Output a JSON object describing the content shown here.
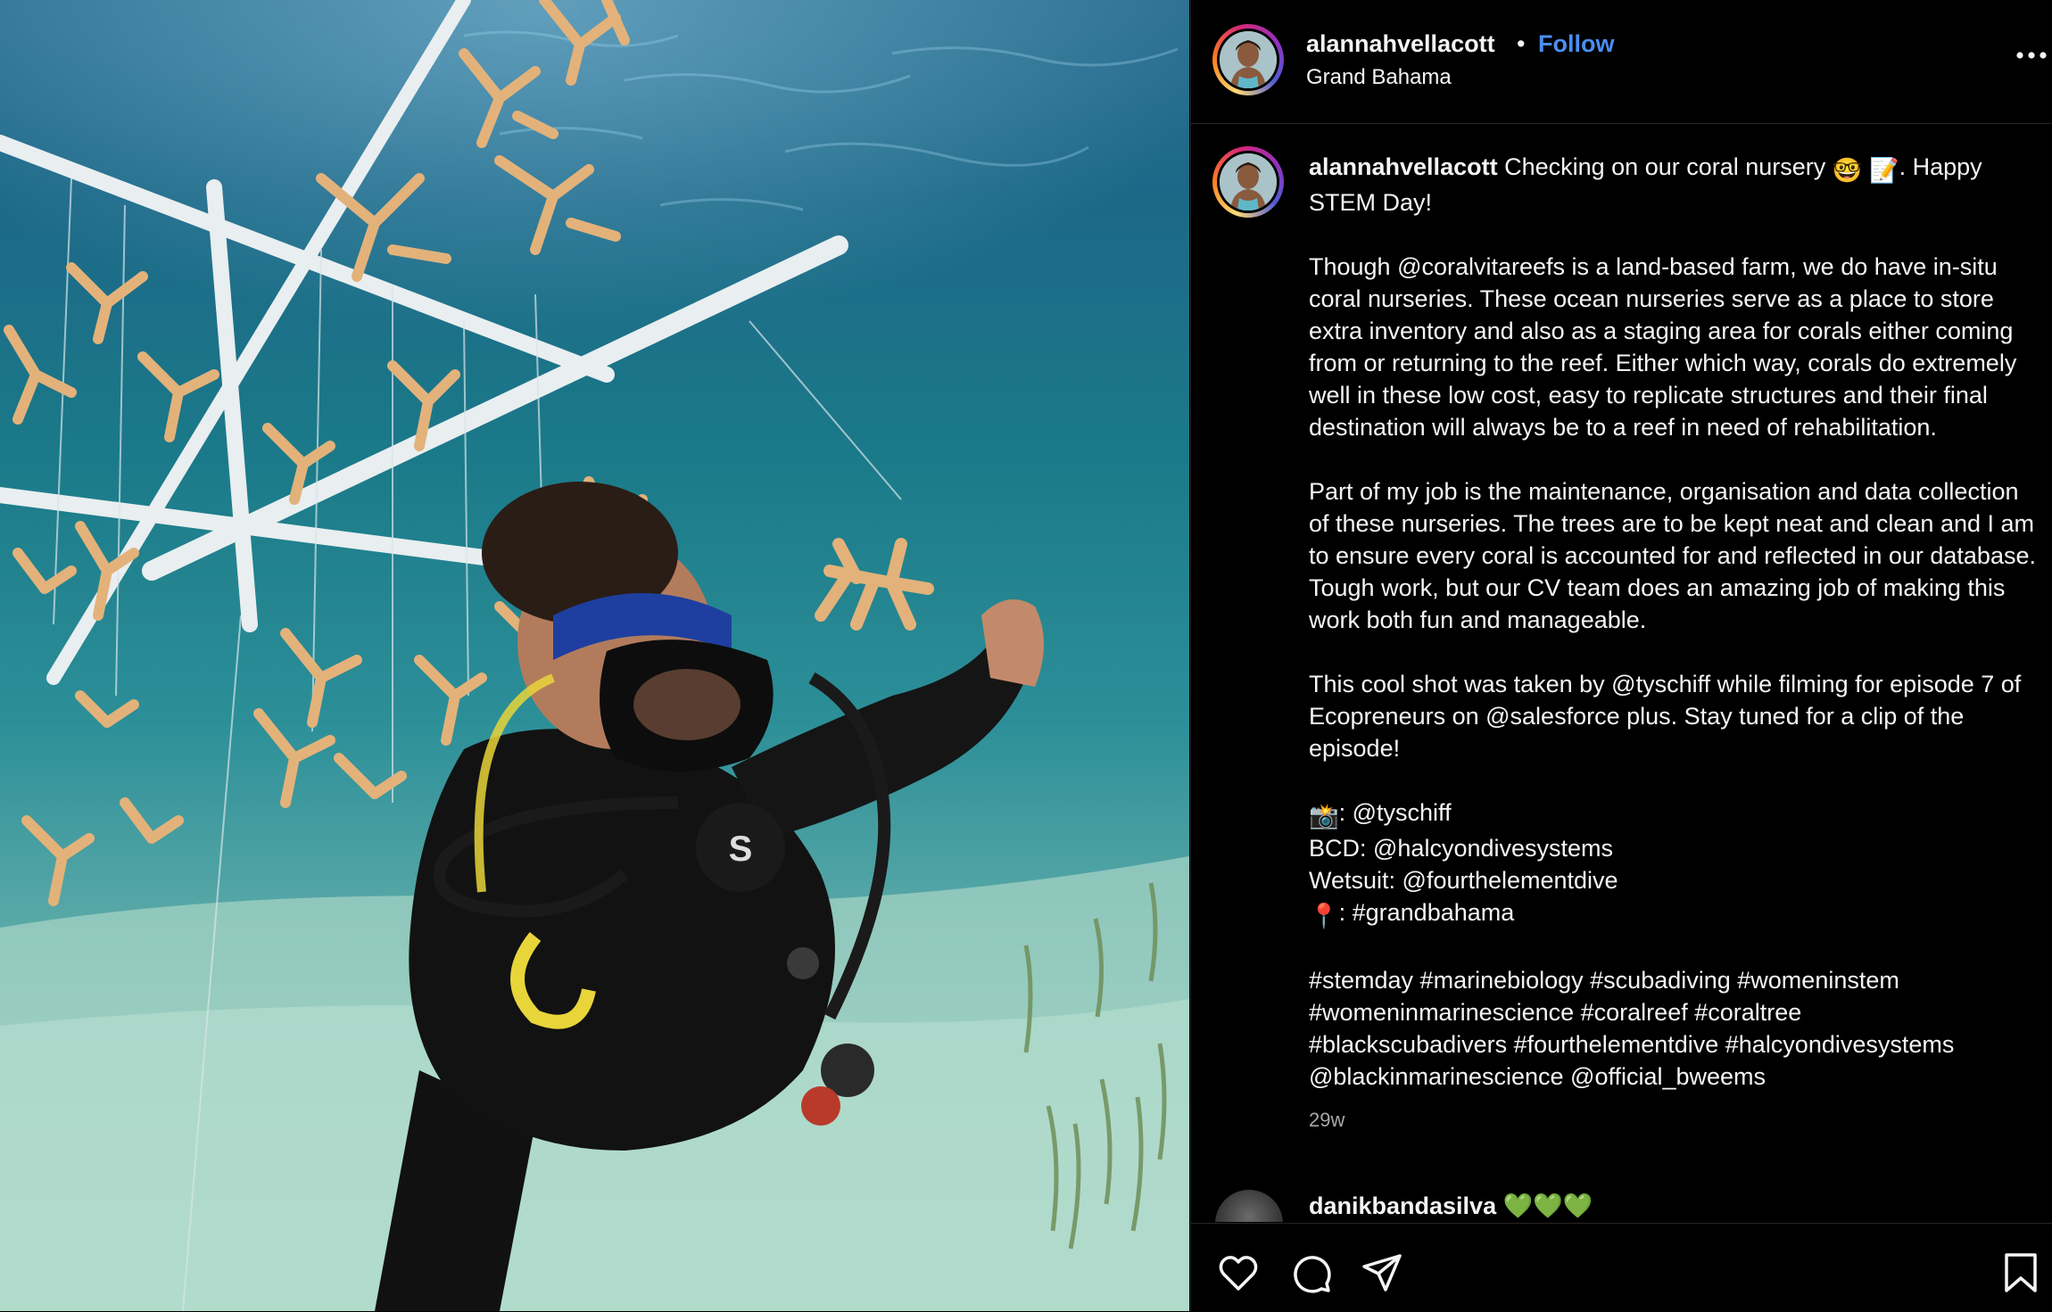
{
  "post": {
    "username": "alannahvellacott",
    "separator": "•",
    "follow_label": "Follow",
    "location": "Grand Bahama"
  },
  "caption": {
    "username": "alannahvellacott",
    "line1": "Checking on our coral nursery",
    "emoji1": "🤓",
    "emoji2": "📝",
    "line1_tail": ". Happy STEM Day!",
    "para1": "Though @coralvitareefs is a land-based farm, we do have in-situ coral nurseries. These ocean nurseries serve as a place to store extra inventory and also as a staging area for corals either coming from or returning to the reef. Either which way, corals do extremely well in these low cost, easy to replicate structures and their final destination will always be to a reef in need of rehabilitation.",
    "para2": "Part of my job is the maintenance, organisation and data collection of these nurseries. The trees are to be kept neat and clean and I am to ensure every coral is accounted for and reflected in our database. Tough work, but our CV team does an amazing job of making this work both fun and manageable.",
    "para3": "This cool shot was taken by @tyschiff while filming for episode 7 of Ecopreneurs on @salesforce plus. Stay tuned for a clip of the episode!",
    "credit_camera_emoji": "📸",
    "credit_camera": ": @tyschiff",
    "credit_bcd": "BCD: @halcyondivesystems",
    "credit_wetsuit": "Wetsuit: @fourthelementdive",
    "credit_pin_emoji": "📍",
    "credit_location": ": #grandbahama",
    "hashtags_line1": "#stemday #marinebiology #scubadiving #womeninstem",
    "hashtags_line2": "#womeninmarinescience #coralreef #coraltree",
    "hashtags_line3": "#blackscubadivers #fourthelementdive #halcyondivesystems",
    "hashtags_line4": "@blackinmarinescience @official_bweems",
    "time": "29w"
  },
  "comment": {
    "username": "danikbandasilva",
    "hearts": "💚💚💚"
  },
  "actions": {
    "like_icon": "heart-icon",
    "comment_icon": "comment-icon",
    "share_icon": "share-icon",
    "save_icon": "bookmark-icon"
  }
}
